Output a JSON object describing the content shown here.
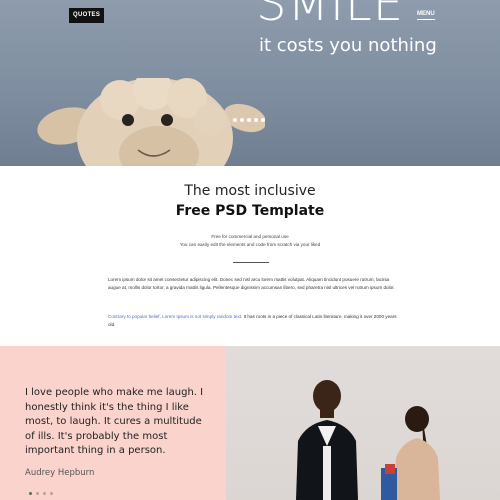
{
  "header": {
    "logo": "QUOTES",
    "menu": "MENU",
    "hero_title": "SMILE",
    "hero_subtitle": "it costs you nothing"
  },
  "slider": {
    "count": 5,
    "active": 0
  },
  "intro": {
    "line1": "The most inclusive",
    "line2": "Free PSD Template",
    "small1": "Free for commercial and personal use",
    "small2": "You can easily edit the elements and code from scratch via your liked",
    "para1": "Lorem ipsum dolor sit amet consectetur adipiscing elit. Donec sed nisl arcu lorem mattis volutpat. Aliquam tincidunt posuere rutrum, lacinia augue at, mollis dolor tortor, a gravida mattis ligula. Pellentesque dignissim accumsan libero, sed pharetra nisl ultrices vel rutrum ipsum dolor.",
    "para2_link": "Contrary to popular belief, Lorem Ipsum is not simply random text.",
    "para2_rest": "It has roots in a piece of classical Latin literature, making it over 2000 years old."
  },
  "quote": {
    "text": "I love people who make me laugh. I honestly think it's the thing I like most, to laugh. It cures a multitude of ills. It's probably the most important thing in a person.",
    "author": "Audrey Hepburn",
    "dots": 4
  },
  "colors": {
    "hero_bg": "#7d8c9e",
    "quote_bg": "#fbd3cd",
    "link": "#4a6fd1"
  },
  "icons": {
    "hero_image": "plush-sheep-illustration",
    "photo": "two-people-laughing-photo"
  }
}
